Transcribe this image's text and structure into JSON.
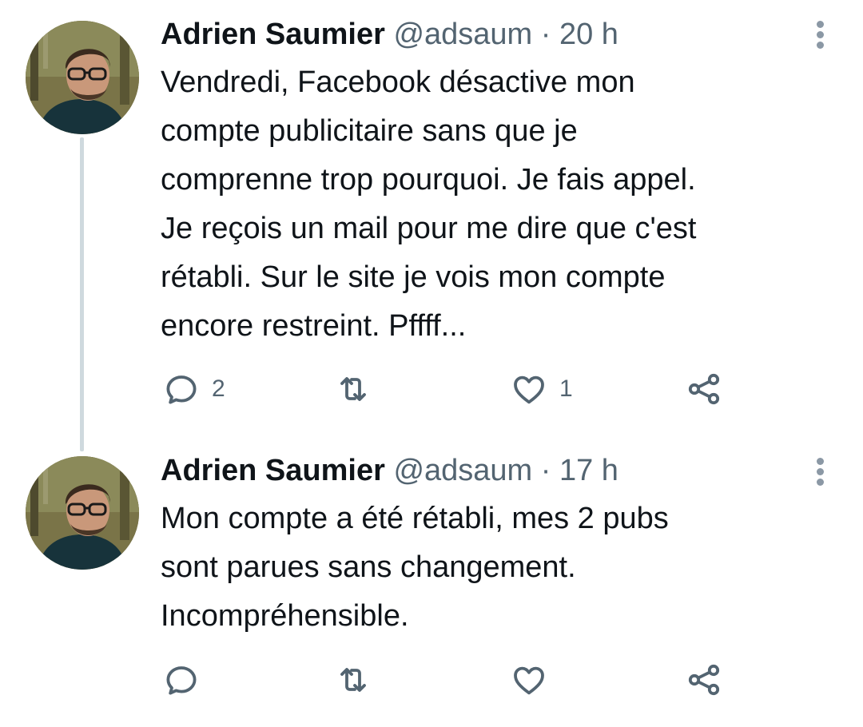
{
  "tweets": [
    {
      "author_name": "Adrien Saumier",
      "handle": "@adsaum",
      "separator": "·",
      "time": "20 h",
      "text_lines": [
        "Vendredi, Facebook désactive mon",
        "compte publicitaire sans que je",
        "comprenne trop pourquoi. Je fais appel.",
        "Je reçois un mail pour me dire que c'est",
        "rétabli. Sur le site je vois mon compte",
        "encore restreint. Pffff..."
      ],
      "reply_count": "2",
      "retweet_count": "",
      "like_count": "1"
    },
    {
      "author_name": "Adrien Saumier",
      "handle": "@adsaum",
      "separator": "·",
      "time": "17 h",
      "text_lines": [
        "Mon compte a été rétabli, mes 2 pubs",
        "sont parues sans changement.",
        "Incompréhensible."
      ],
      "reply_count": "",
      "retweet_count": "",
      "like_count": ""
    }
  ],
  "icons": {
    "reply": "reply-icon",
    "retweet": "retweet-icon",
    "like": "heart-icon",
    "share": "share-icon",
    "more": "more-vertical-icon"
  },
  "colors": {
    "text": "#0f1419",
    "secondary": "#536471",
    "thread_line": "#cfd9de"
  }
}
